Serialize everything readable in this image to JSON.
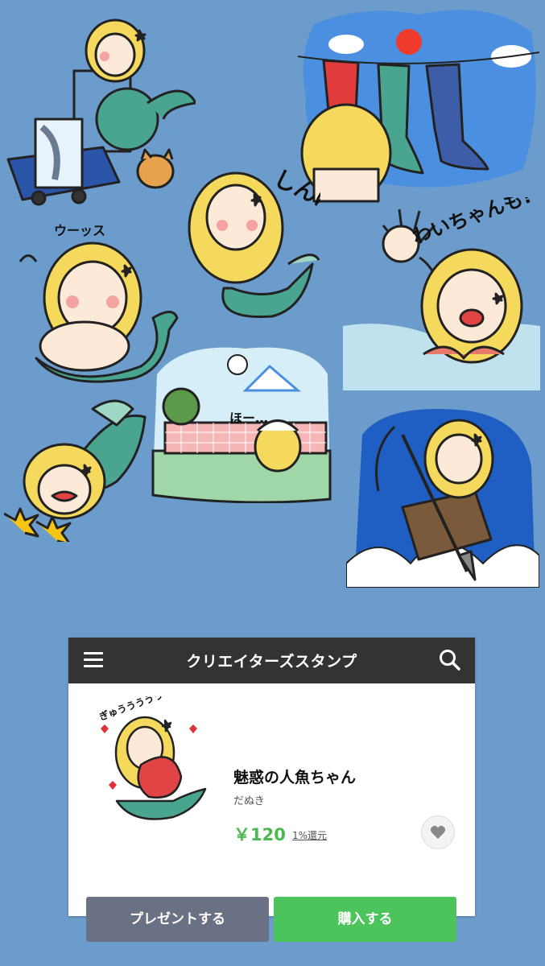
{
  "colors": {
    "background": "#6b9ccb",
    "header": "#333333",
    "buy": "#4dc35b",
    "gift": "#6b7185",
    "price": "#4cb94f"
  },
  "stickers": [
    {
      "name": "sticker-cart-mermaid",
      "caption": ""
    },
    {
      "name": "sticker-laundry-tails",
      "caption": ""
    },
    {
      "name": "sticker-worried-mermaid",
      "caption": "しんぱい"
    },
    {
      "name": "sticker-waving-mermaid",
      "caption": "わいちゃんも!"
    },
    {
      "name": "sticker-chubby-mermaid",
      "caption": "ウーッス"
    },
    {
      "name": "sticker-crying-mermaid",
      "caption": ""
    },
    {
      "name": "sticker-onsen-mermaid",
      "caption": "ほー…"
    },
    {
      "name": "sticker-harpoon-mermaid",
      "caption": ""
    }
  ],
  "header": {
    "title": "クリエイターズスタンプ",
    "menu_icon": "hamburger-icon",
    "search_icon": "search-icon"
  },
  "product": {
    "title": "魅惑の人魚ちゃん",
    "author": "だぬき",
    "price": "￥120",
    "cashback": "1%還元",
    "thumb_caption": "ぎゅううううう",
    "favorite_icon": "heart-icon"
  },
  "buttons": {
    "gift": "プレゼントする",
    "buy": "購入する"
  }
}
